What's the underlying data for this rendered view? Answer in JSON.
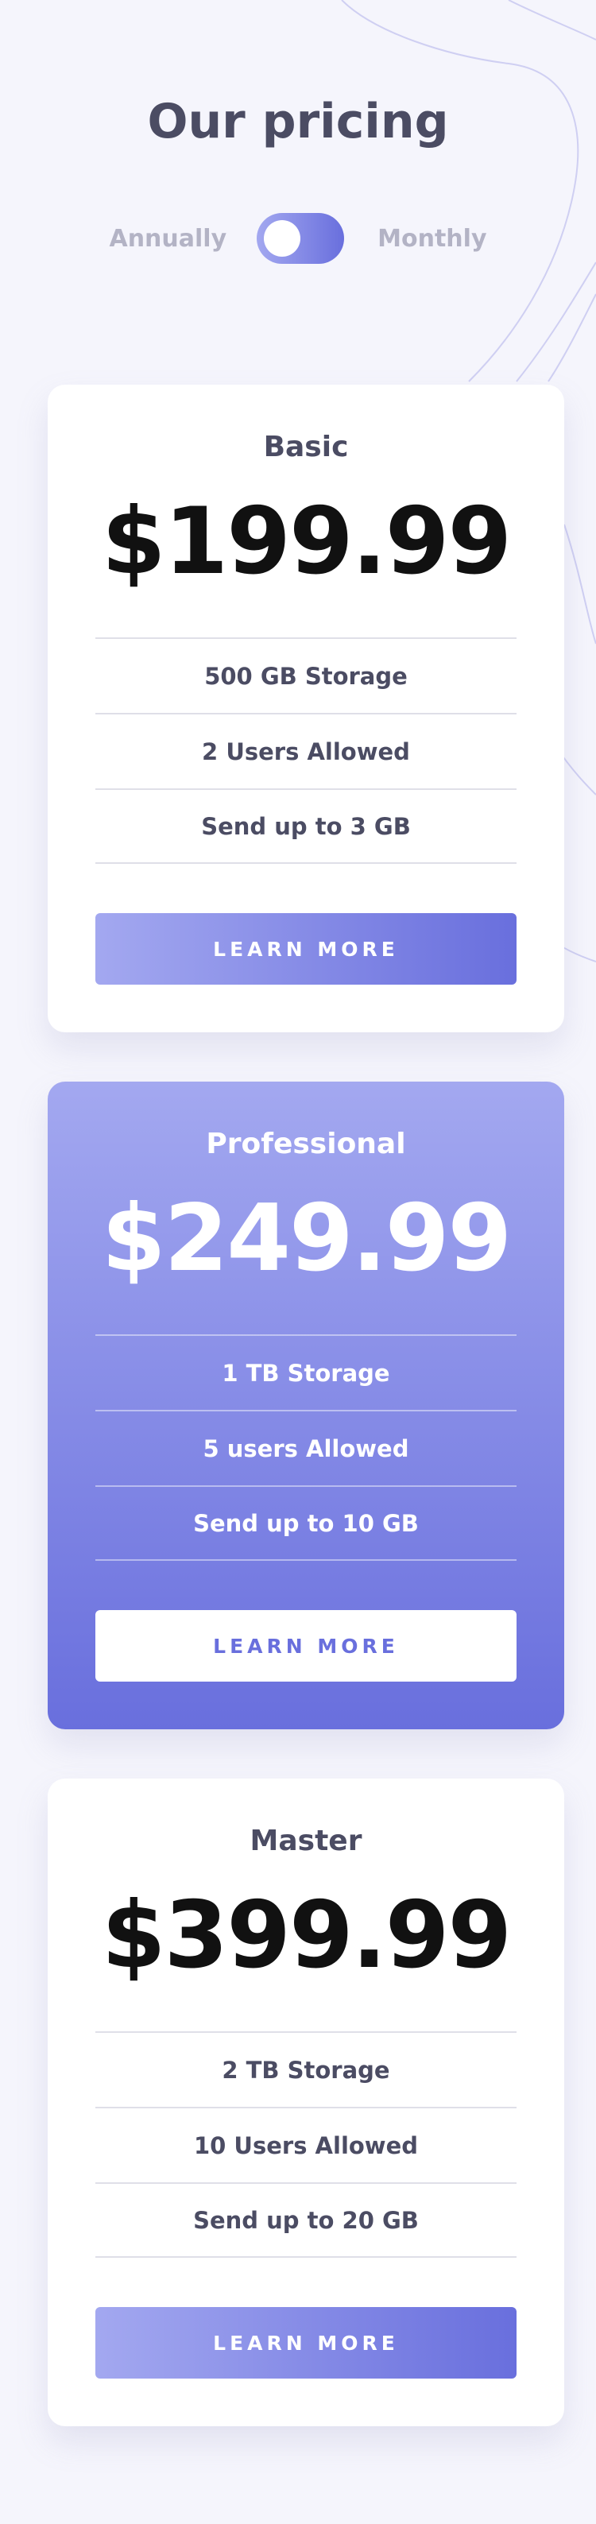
{
  "header": {
    "title": "Our pricing"
  },
  "billing_toggle": {
    "left_label": "Annually",
    "right_label": "Monthly"
  },
  "colors": {
    "accent_start": "#a3a8f0",
    "accent_end": "#696fdd",
    "text_dark": "#4b4c63",
    "text_muted": "#b3b3c5",
    "background": "#f5f5fc"
  },
  "plans": [
    {
      "name": "Basic",
      "price": "$199.99",
      "features": [
        "500 GB Storage",
        "2 Users Allowed",
        "Send up to 3 GB"
      ],
      "cta": "LEARN MORE"
    },
    {
      "name": "Professional",
      "price": "$249.99",
      "features": [
        "1 TB Storage",
        "5 users Allowed",
        "Send up to 10 GB"
      ],
      "cta": "LEARN MORE"
    },
    {
      "name": "Master",
      "price": "$399.99",
      "features": [
        "2 TB Storage",
        "10 Users Allowed",
        "Send up to 20 GB"
      ],
      "cta": "LEARN MORE"
    }
  ]
}
